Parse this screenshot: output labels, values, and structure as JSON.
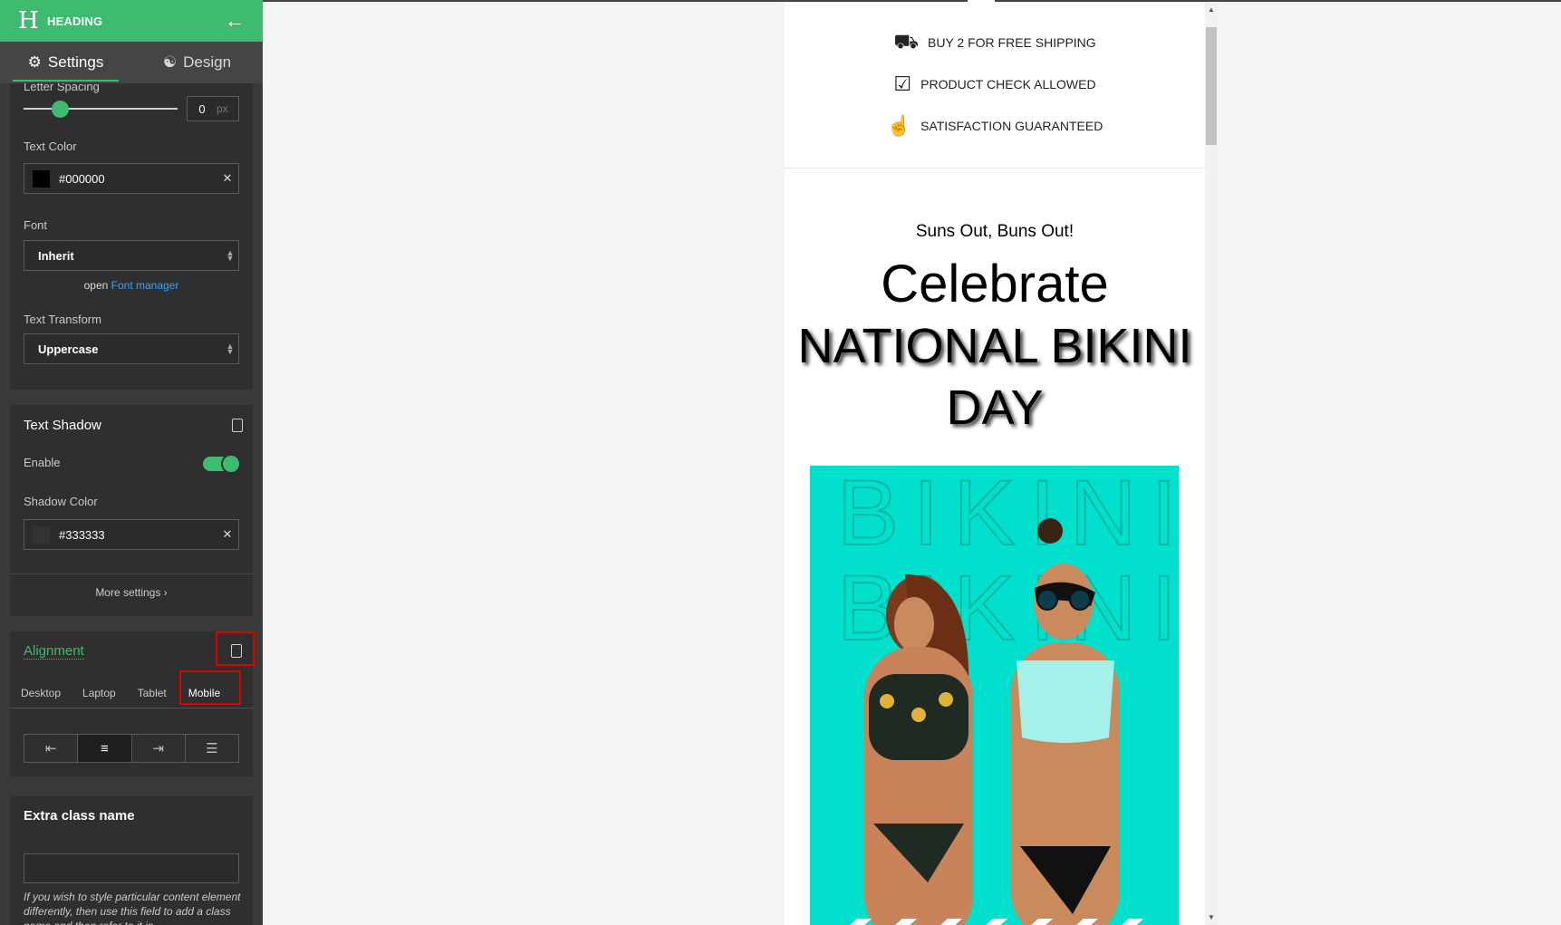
{
  "sidebar": {
    "header": {
      "logo": "H",
      "title": "HEADING",
      "back_icon": "arrow-left-icon"
    },
    "tabs": [
      {
        "label": "Settings",
        "icon": "gear-icon",
        "active": true
      },
      {
        "label": "Design",
        "icon": "palette-icon",
        "active": false
      }
    ],
    "typography": {
      "letter_spacing_label": "Letter Spacing",
      "letter_spacing_value": "0",
      "letter_spacing_unit": "px",
      "text_color_label": "Text Color",
      "text_color_value": "#000000",
      "font_label": "Font",
      "font_value": "Inherit",
      "font_manager_prefix": "open",
      "font_manager_link": "Font manager",
      "text_transform_label": "Text Transform",
      "text_transform_value": "Uppercase"
    },
    "text_shadow": {
      "title": "Text Shadow",
      "enable_label": "Enable",
      "enabled": true,
      "shadow_color_label": "Shadow Color",
      "shadow_color_value": "#333333",
      "more_settings": "More settings ›"
    },
    "alignment": {
      "title": "Alignment",
      "devices": [
        "Desktop",
        "Laptop",
        "Tablet",
        "Mobile"
      ],
      "active_device": "Mobile",
      "options": [
        "align-left-icon",
        "align-center-icon",
        "align-right-icon",
        "align-justify-icon"
      ],
      "selected_option": "align-center-icon"
    },
    "extra_class": {
      "title": "Extra class name",
      "value": "",
      "help": "If you wish to style particular content element differently, then use this field to add a class name and then refer to it in"
    }
  },
  "preview": {
    "usps": [
      {
        "icon": "truck-icon",
        "text": "BUY 2 FOR FREE SHIPPING"
      },
      {
        "icon": "box-check-icon",
        "text": "PRODUCT CHECK ALLOWED"
      },
      {
        "icon": "thumbs-up-icon",
        "text": "SATISFACTION GUARANTEED"
      }
    ],
    "subheading": "Suns Out, Buns Out!",
    "headline_line1": "Celebrate",
    "headline_line2": "NATIONAL BIKINI DAY",
    "hero_watermark": "BIKINI"
  },
  "colors": {
    "accent": "#3dbb6f",
    "sidebar_bg": "#3a3a3a",
    "panel_bg": "#2f2f2f",
    "hero_bg": "#00e0cc",
    "highlight": "#e00000"
  }
}
